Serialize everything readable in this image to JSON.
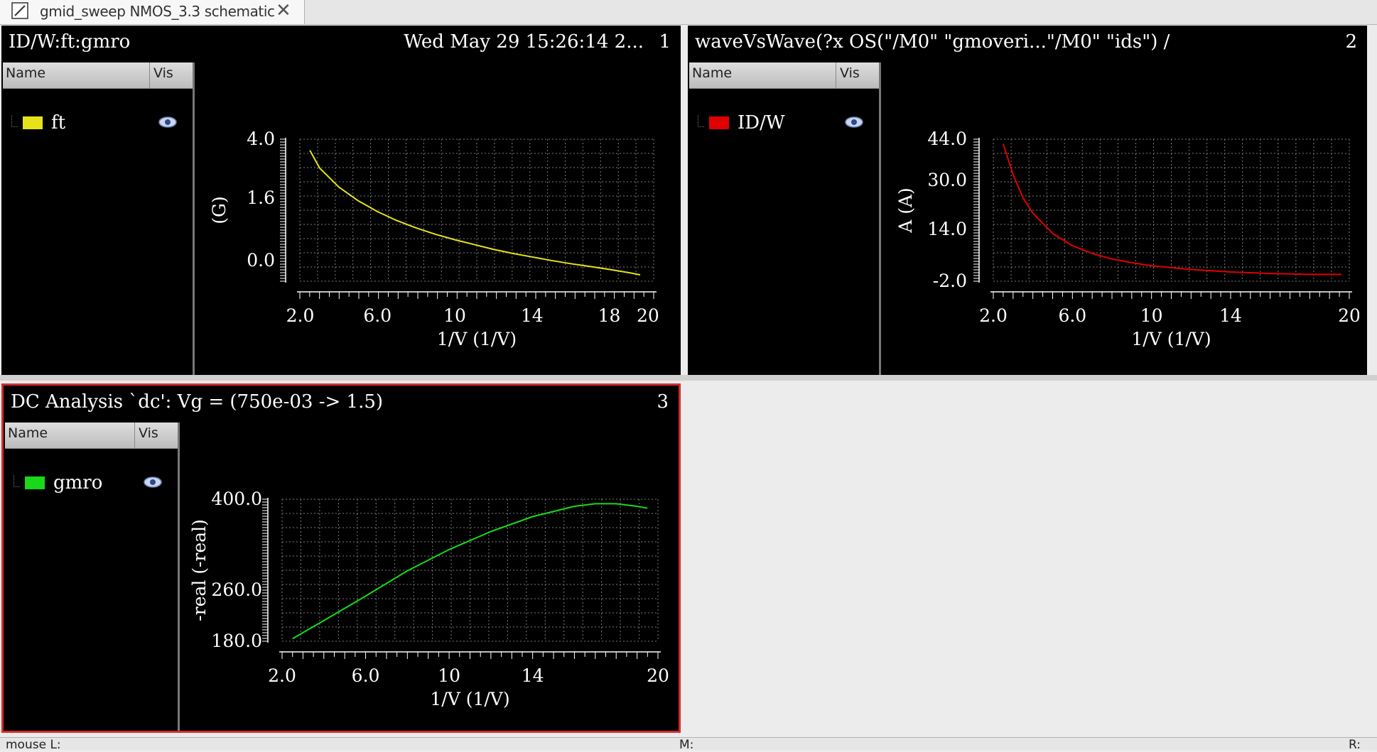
{
  "tab": {
    "label": "gmid_sweep NMOS_3.3 schematic",
    "close_glyph": "✕"
  },
  "legend_header": {
    "name": "Name",
    "vis": "Vis"
  },
  "status": {
    "left": "mouse L:",
    "mid": "M:",
    "right": "R:"
  },
  "panels": [
    {
      "title": "ID/W:ft:gmro",
      "date": "Wed May 29 15:26:14 2...",
      "number": "1",
      "signal": "ft",
      "color": "#e6e21a"
    },
    {
      "title": "waveVsWave(?x OS(\"/M0\" \"gmoveri...\"/M0\" \"ids\") /",
      "number": "2",
      "signal": "ID/W",
      "color": "#e00000"
    },
    {
      "title": "DC Analysis `dc': Vg = (750e-03 -> 1.5)",
      "number": "3",
      "signal": "gmro",
      "color": "#18d818"
    }
  ],
  "chart_data": [
    {
      "type": "line",
      "xlabel": "1/V (1/V)",
      "ylabel": "(G)",
      "xlim": [
        1.98,
        20.3
      ],
      "ylim": [
        -0.1,
        4.35
      ],
      "xticks": [
        "2.0",
        "6.0",
        "10",
        "14",
        "18",
        "20"
      ],
      "xtick_values": [
        2,
        6,
        10,
        14,
        18,
        20
      ],
      "yticks": [
        "4.0",
        "1.6",
        "0.0"
      ],
      "ytick_values": [
        4.35,
        1.6,
        -0.1
      ],
      "grid": true,
      "series": [
        {
          "name": "ft",
          "color": "#e6e21a",
          "x": [
            2.5,
            3,
            4,
            5,
            6,
            7,
            8,
            9,
            10,
            11,
            12,
            13,
            14,
            15,
            16,
            17,
            18,
            19,
            19.6
          ],
          "y": [
            4.0,
            3.45,
            2.85,
            2.42,
            2.08,
            1.8,
            1.57,
            1.37,
            1.2,
            1.05,
            0.9,
            0.77,
            0.66,
            0.55,
            0.45,
            0.36,
            0.27,
            0.17,
            0.1
          ]
        }
      ]
    },
    {
      "type": "line",
      "xlabel": "1/V (1/V)",
      "ylabel": "A (A)",
      "xlim": [
        2.0,
        20.0
      ],
      "ylim": [
        -2.0,
        44.0
      ],
      "xticks": [
        "2.0",
        "6.0",
        "10",
        "14",
        "20"
      ],
      "xtick_values": [
        2,
        6,
        10,
        14,
        20
      ],
      "yticks": [
        "44.0",
        "30.0",
        "14.0",
        "-2.0"
      ],
      "ytick_values": [
        44,
        30,
        14,
        -2
      ],
      "grid": true,
      "series": [
        {
          "name": "ID/W",
          "color": "#e00000",
          "x": [
            2.5,
            3,
            3.5,
            4,
            5,
            6,
            7,
            8,
            9,
            10,
            12,
            14,
            16,
            18,
            19.6
          ],
          "y": [
            42.5,
            32.5,
            25,
            20,
            13.5,
            9.5,
            7,
            5.2,
            4,
            3,
            1.8,
            1.0,
            0.5,
            0.2,
            0.2
          ]
        }
      ]
    },
    {
      "type": "line",
      "xlabel": "1/V (1/V)",
      "ylabel": "-real (-real)",
      "xlim": [
        2.0,
        20.0
      ],
      "ylim": [
        180.0,
        400.0
      ],
      "xticks": [
        "2.0",
        "6.0",
        "10",
        "14",
        "20"
      ],
      "xtick_values": [
        2,
        6,
        10,
        14,
        20
      ],
      "yticks": [
        "400.0",
        "260.0",
        "180.0"
      ],
      "ytick_values": [
        400,
        260,
        180
      ],
      "grid": true,
      "series": [
        {
          "name": "gmro",
          "color": "#18d818",
          "x": [
            2.5,
            4,
            6,
            8,
            10,
            12,
            14,
            16,
            17,
            18,
            19,
            19.5
          ],
          "y": [
            184,
            212,
            250,
            289,
            322,
            350,
            373,
            389,
            393,
            393,
            389,
            386
          ]
        }
      ]
    }
  ]
}
